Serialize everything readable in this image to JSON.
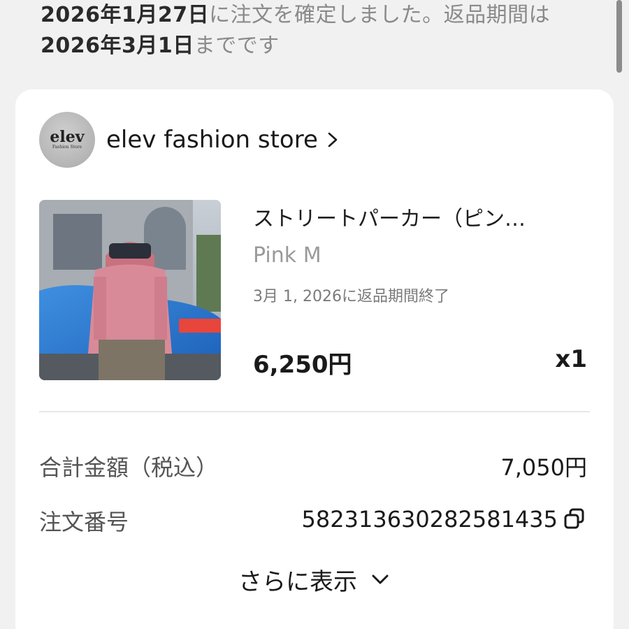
{
  "notice": {
    "date_confirmed": "2026年1月27日",
    "text_confirmed": "に注文を確定しました。返品期間は",
    "return_deadline": "2026年3月1日",
    "text_until": "までです"
  },
  "store": {
    "logo_text": "elev",
    "logo_subtext": "Fashion Store",
    "name": "elev fashion store"
  },
  "product": {
    "title": "ストリートパーカー（ピン…",
    "variant": "Pink M",
    "return_period": "3月 1, 2026に返品期間終了",
    "price": "6,250円",
    "quantity": "x1"
  },
  "summary": {
    "total_label": "合計金額（税込）",
    "total_value": "7,050円",
    "order_label": "注文番号",
    "order_value": "582313630282581435"
  },
  "show_more_label": "さらに表示",
  "icons": {
    "store_chevron": "chevron-right-icon",
    "copy": "copy-icon",
    "show_more_chevron": "chevron-down-icon"
  }
}
